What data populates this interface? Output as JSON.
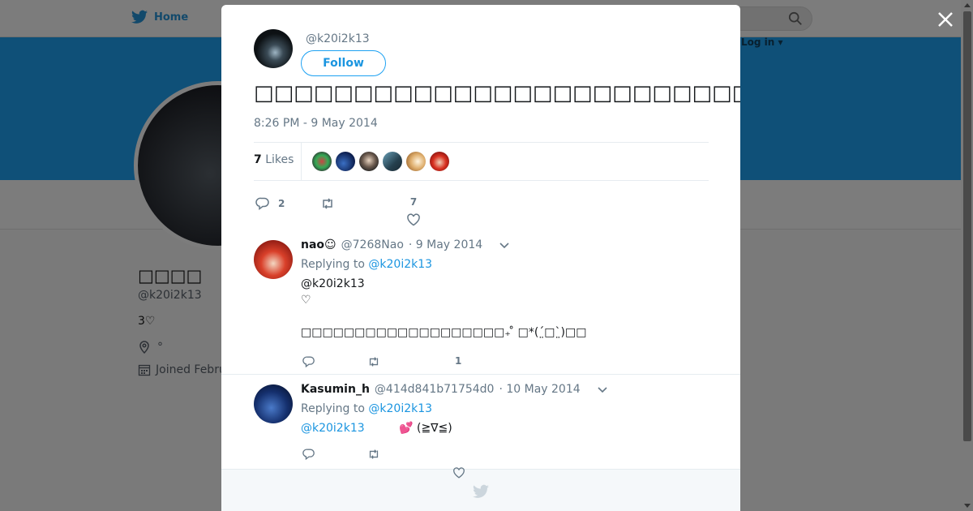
{
  "background": {
    "nav_home": "Home",
    "login": "Log in ▾",
    "profile_name": "□□□□",
    "profile_handle": "@k20i2k13",
    "bio": "3♡",
    "location": "°",
    "joined": "Joined Febru"
  },
  "modal": {
    "author_handle": "@k20i2k13",
    "follow_label": "Follow",
    "tweet_text": "□□□□□□□□□□□□□□□□□□□□□□□□□□□□□□♡□□□□□□□□□□□□□□□□□□□□□□□( ´□□)",
    "timestamp": "8:26 PM - 9 May 2014",
    "likes_count": "7",
    "likes_label": "Likes",
    "reply_count": "2",
    "like_count": "7"
  },
  "replies": [
    {
      "name": "nao☺",
      "handle": "@7268Nao",
      "date": "· 9 May 2014",
      "replying_label": "Replying to",
      "replying_to": "@k20i2k13",
      "mention": "@k20i2k13",
      "line1": "♡",
      "line2": "□□□□□□□□□□□□□□□□□□□₊ ̊ □*(ˊ̤□ˋ̤)□□",
      "like_count": "1"
    },
    {
      "name": "Kasumin_h",
      "handle": "@414d841b71754d0",
      "date": "· 10 May 2014",
      "replying_label": "Replying to",
      "replying_to": "@k20i2k13",
      "mention": "@k20i2k13",
      "text": "💕 (≧∇≦)",
      "like_count": ""
    }
  ],
  "colors": {
    "accent": "#1da1f2",
    "link": "#1b95e0",
    "muted": "#657786",
    "text": "#14171a"
  },
  "icons": [
    "twitter-bird-icon",
    "search-icon",
    "close-icon",
    "reply-icon",
    "retweet-icon",
    "heart-icon",
    "chevron-down-icon",
    "location-icon",
    "calendar-icon"
  ]
}
